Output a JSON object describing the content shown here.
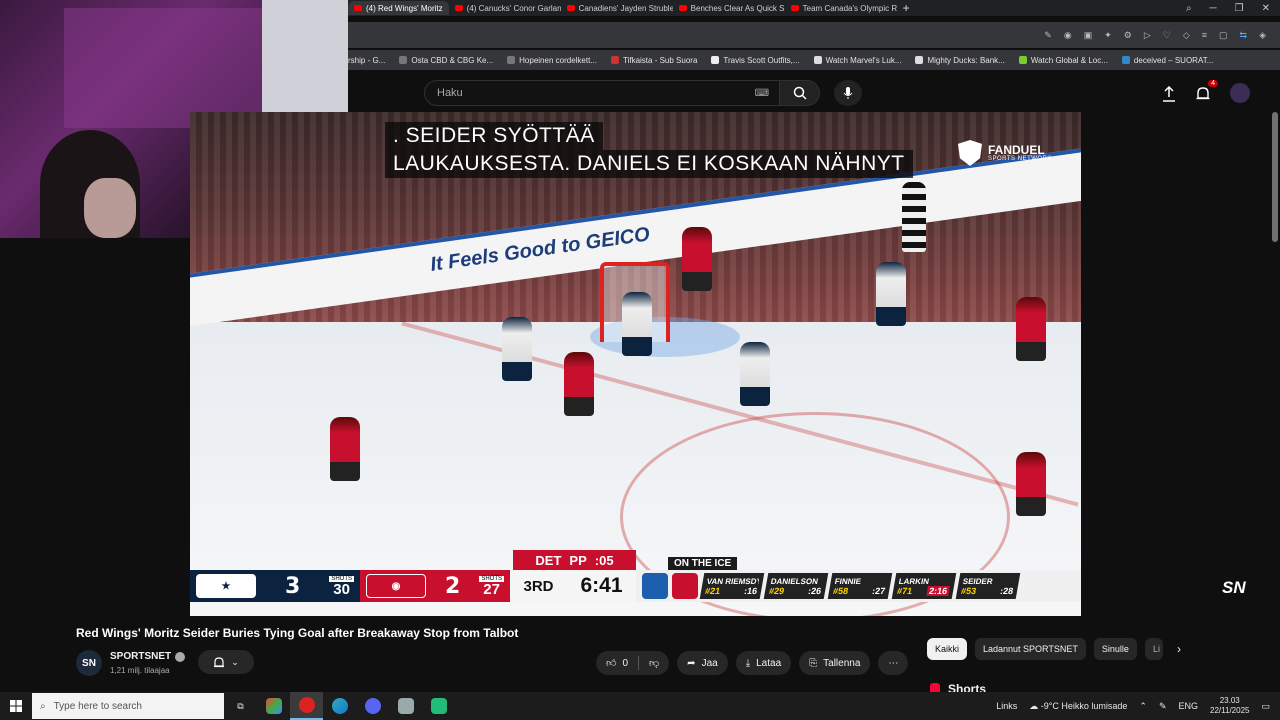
{
  "browser": {
    "tabs": [
      {
        "label": "(4) Red Wings' Moritz",
        "active": true
      },
      {
        "label": "(4) Canucks' Conor Garlan",
        "active": false
      },
      {
        "label": "Canadiens' Jayden Struble",
        "active": false
      },
      {
        "label": "Benches Clear As Quick Si",
        "active": false
      },
      {
        "label": "Team Canada's Olympic R",
        "active": false
      }
    ],
    "new_tab": "+",
    "bookmarks": [
      "rship - G...",
      "Osta CBD & CBG Ke...",
      "Hopeinen cordelkett...",
      "Tifkaista - Sub Suora",
      "Travis Scott Outfits,...",
      "Watch Marvel's Luk...",
      "Mighty Ducks: Bank...",
      "Watch Global & Loc...",
      "deceived – SUORAT..."
    ]
  },
  "header": {
    "search_placeholder": "Haku",
    "notification_count": "4"
  },
  "video": {
    "caption_line1": ". SEIDER SYÖTTÄÄ",
    "caption_line2": "LAUKAUKSESTA.  DANIELS EI KOSKAAN NÄHNYT",
    "sponsor_name": "FANDUEL",
    "sponsor_sub": "SPORTS NETWORK",
    "boards_text": "It Feels Good to GEICO",
    "broadcaster_logo": "SN"
  },
  "scorebug": {
    "away": {
      "score": "3",
      "shots_label": "SHOTS",
      "shots": "30",
      "color": "#0c2340"
    },
    "home": {
      "score": "2",
      "shots_label": "SHOTS",
      "shots": "27",
      "color": "#c8102e"
    },
    "power_play": {
      "team": "DET",
      "label": "PP",
      "time": ":05"
    },
    "period": "3RD",
    "clock": "6:41",
    "on_ice_label": "ON THE ICE",
    "players": [
      {
        "name": "VAN RIEMSDYK",
        "number": "#21",
        "toi": ":16",
        "penalty": false
      },
      {
        "name": "DANIELSON",
        "number": "#29",
        "toi": ":26",
        "penalty": false
      },
      {
        "name": "FINNIE",
        "number": "#58",
        "toi": ":27",
        "penalty": false
      },
      {
        "name": "LARKIN",
        "number": "#71",
        "toi": "2:16",
        "penalty": true
      },
      {
        "name": "SEIDER",
        "number": "#53",
        "toi": ":28",
        "penalty": false
      }
    ]
  },
  "meta": {
    "title": "Red Wings' Moritz Seider Buries Tying Goal after Breakaway Stop from Talbot",
    "channel": "SPORTSNET",
    "channel_avatar": "SN",
    "subscribers": "1,21 milj. tilaajaa",
    "like_count": "0",
    "share": "Jaa",
    "download": "Lataa",
    "save": "Tallenna"
  },
  "chips": [
    "Kaikki",
    "Ladannut SPORTSNET",
    "Sinulle",
    "Li"
  ],
  "shorts_label": "Shorts",
  "taskbar": {
    "search_placeholder": "Type here to search",
    "links": "Links",
    "weather": "-9°C  Heikko lumisade",
    "lang": "ENG",
    "time": "23.03",
    "date": "22/11/2025"
  }
}
